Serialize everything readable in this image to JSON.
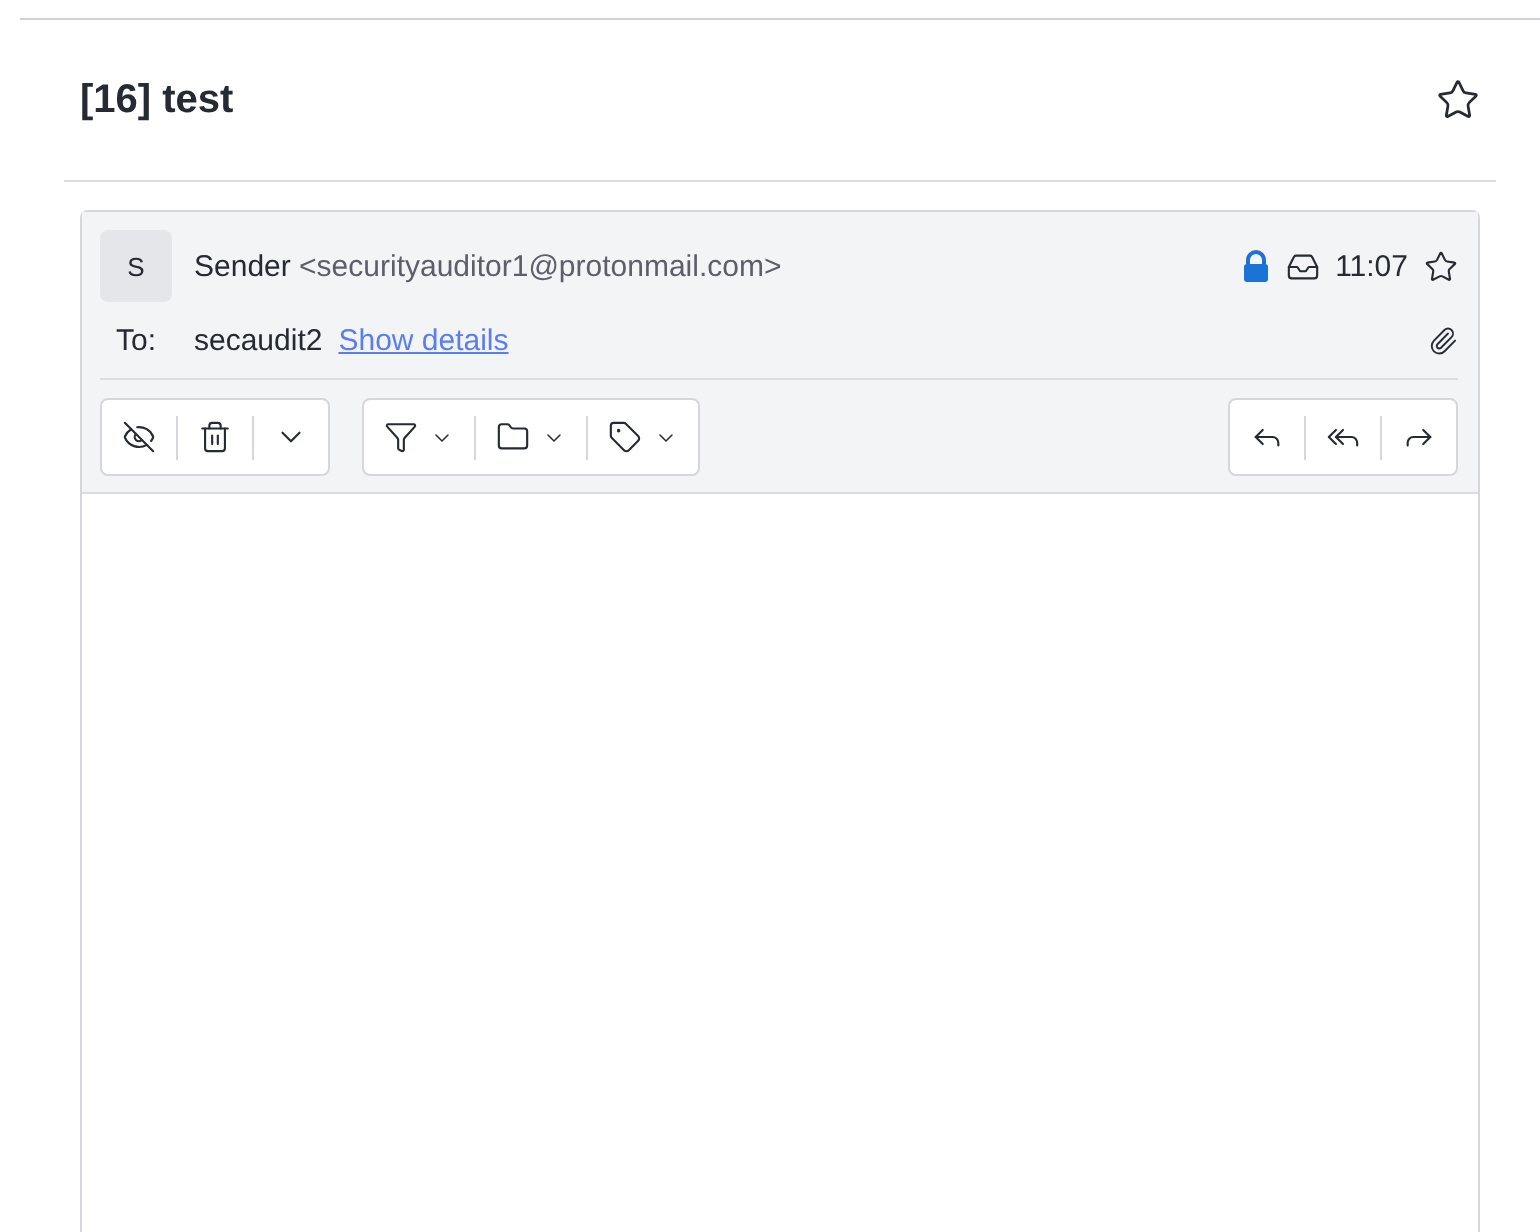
{
  "conversation": {
    "title": "[16] test",
    "starred": false
  },
  "message": {
    "avatar": "S",
    "sender_name": "Sender",
    "sender_address": "<securityauditor1@protonmail.com>",
    "encrypted": true,
    "time": "11:07",
    "starred": false,
    "to_label": "To:",
    "recipient": "secaudit2",
    "details_link": "Show details",
    "has_attachment": true
  }
}
